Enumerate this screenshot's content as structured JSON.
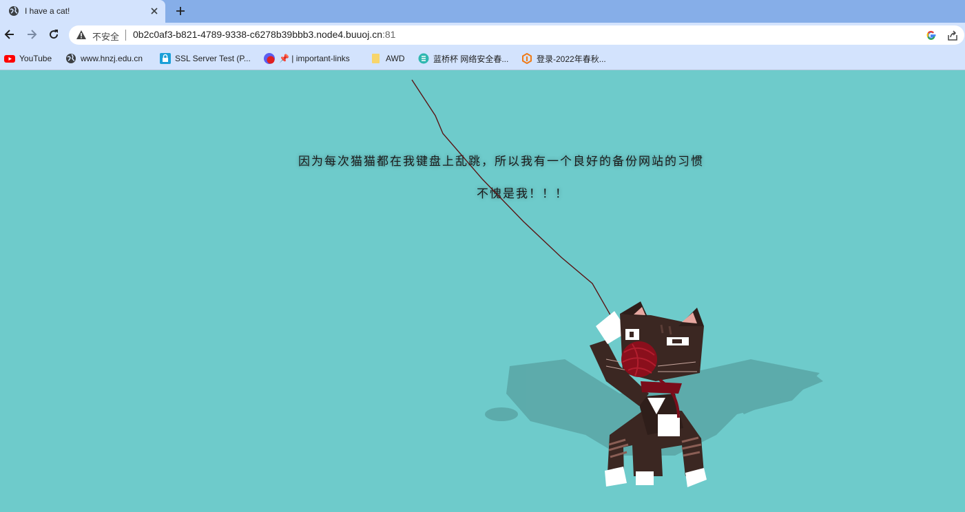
{
  "browser": {
    "tab_title": "I have a cat!",
    "security_label": "不安全",
    "url_host": "0b2c0af3-b821-4789-9338-c6278b39bbb3.node4.buuoj.cn",
    "url_port": ":81"
  },
  "bookmarks": [
    {
      "label": "YouTube",
      "icon": "youtube-icon"
    },
    {
      "label": "www.hnzj.edu.cn",
      "icon": "globe-icon"
    },
    {
      "label": "SSL Server Test (P...",
      "icon": "lock-icon"
    },
    {
      "label": "📌 | important-links",
      "icon": "badge-20-icon"
    },
    {
      "label": "AWD",
      "icon": "folder-icon"
    },
    {
      "label": "蓝桥杯 网络安全春...",
      "icon": "lanqiao-icon"
    },
    {
      "label": "登录-2022年春秋...",
      "icon": "ichunqiu-icon"
    }
  ],
  "page": {
    "line1": "因为每次猫猫都在我键盘上乱跳，所以我有一个良好的备份网站的习惯",
    "line2": "不愧是我！！！",
    "background_color": "#6ecbcb"
  }
}
